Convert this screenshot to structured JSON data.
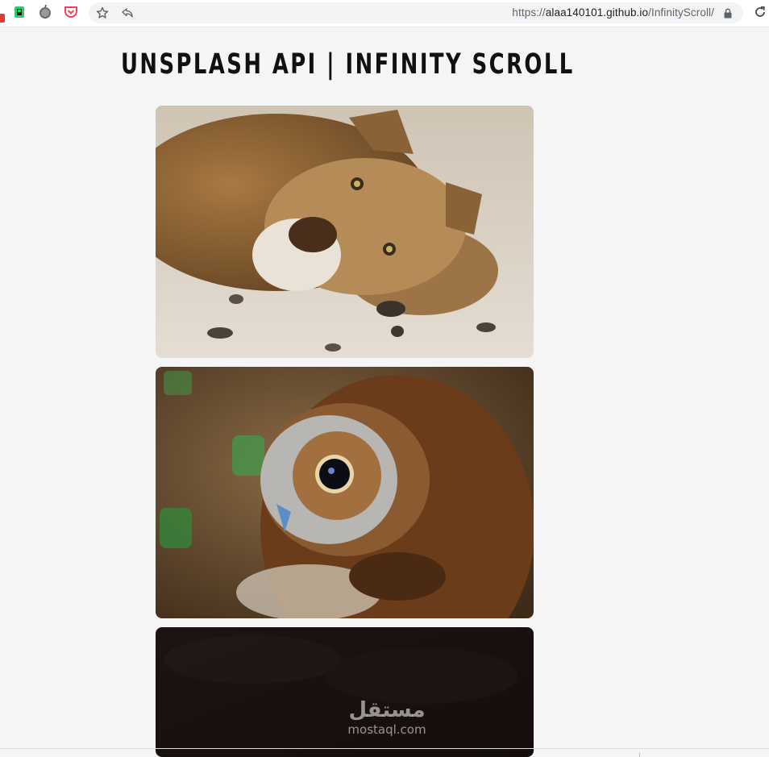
{
  "browser": {
    "url_scheme": "https://",
    "url_host": "alaa140101.github.io",
    "url_path": "/InfinityScroll/",
    "icons": [
      "extension-icon",
      "apple-icon",
      "pocket-icon",
      "star-icon",
      "share-icon",
      "lock-icon",
      "reload-icon"
    ]
  },
  "page": {
    "title": "UNSPLASH API | INFINITY SCROLL"
  },
  "photos": [
    {
      "subject": "lion"
    },
    {
      "subject": "owl"
    },
    {
      "subject": "dark"
    }
  ],
  "watermark": {
    "arabic": "مستقل",
    "latin": "mostaql.com"
  },
  "colors": {
    "page_bg": "#f5f5f5",
    "title": "#111111",
    "toolbar_bg": "#ffffff",
    "omnibox_bg": "#f1f3f4"
  }
}
